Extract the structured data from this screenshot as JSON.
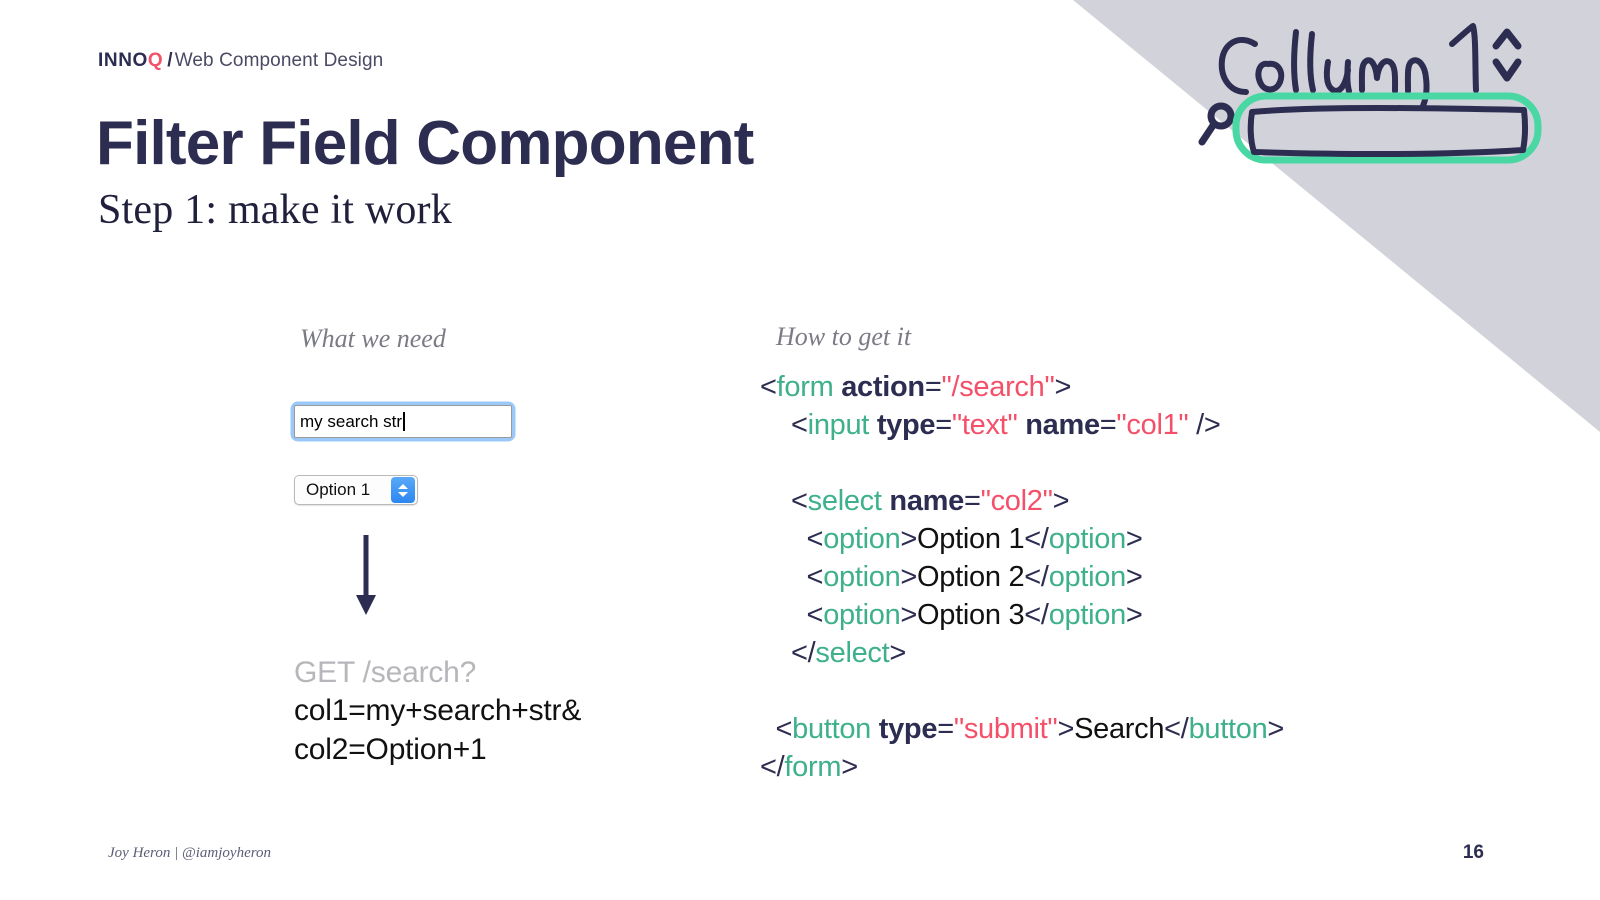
{
  "brand": {
    "name_dark": "INNO",
    "name_accent": "Q",
    "separator": "/",
    "deck_title": "Web Component Design"
  },
  "slide": {
    "title": "Filter Field Component",
    "subtitle": "Step 1: make it work",
    "page_number": "16",
    "credit": "Joy Heron | @iamjoyheron"
  },
  "columns": {
    "left_caption": "What we need",
    "right_caption": "How to get it"
  },
  "demo": {
    "search_input_value": "my search str",
    "search_input_placeholder": "",
    "select_value": "Option 1",
    "select_options": [
      "Option 1",
      "Option 2",
      "Option 3"
    ],
    "arrow_icon": "arrow-down-icon",
    "request_method_path": "GET /search?",
    "request_param_1": "col1=my+search+str&",
    "request_param_2": "col2=Option+1"
  },
  "code": {
    "lines": [
      [
        {
          "t": "<",
          "c": "punc"
        },
        {
          "t": "form",
          "c": "tag"
        },
        {
          "t": " ",
          "c": "punc"
        },
        {
          "t": "action",
          "c": "attr"
        },
        {
          "t": "=",
          "c": "punc"
        },
        {
          "t": "\"/search\"",
          "c": "val"
        },
        {
          "t": ">",
          "c": "punc"
        }
      ],
      [
        {
          "t": "    <",
          "c": "punc"
        },
        {
          "t": "input",
          "c": "tag"
        },
        {
          "t": " ",
          "c": "punc"
        },
        {
          "t": "type",
          "c": "attr"
        },
        {
          "t": "=",
          "c": "punc"
        },
        {
          "t": "\"text\"",
          "c": "val"
        },
        {
          "t": " ",
          "c": "punc"
        },
        {
          "t": "name",
          "c": "attr"
        },
        {
          "t": "=",
          "c": "punc"
        },
        {
          "t": "\"col1\"",
          "c": "val"
        },
        {
          "t": " />",
          "c": "punc"
        }
      ],
      [],
      [
        {
          "t": "    <",
          "c": "punc"
        },
        {
          "t": "select",
          "c": "tag"
        },
        {
          "t": " ",
          "c": "punc"
        },
        {
          "t": "name",
          "c": "attr"
        },
        {
          "t": "=",
          "c": "punc"
        },
        {
          "t": "\"col2\"",
          "c": "val"
        },
        {
          "t": ">",
          "c": "punc"
        }
      ],
      [
        {
          "t": "      <",
          "c": "punc"
        },
        {
          "t": "option",
          "c": "tag"
        },
        {
          "t": ">",
          "c": "punc"
        },
        {
          "t": "Option 1",
          "c": "text"
        },
        {
          "t": "</",
          "c": "punc"
        },
        {
          "t": "option",
          "c": "tag"
        },
        {
          "t": ">",
          "c": "punc"
        }
      ],
      [
        {
          "t": "      <",
          "c": "punc"
        },
        {
          "t": "option",
          "c": "tag"
        },
        {
          "t": ">",
          "c": "punc"
        },
        {
          "t": "Option 2",
          "c": "text"
        },
        {
          "t": "</",
          "c": "punc"
        },
        {
          "t": "option",
          "c": "tag"
        },
        {
          "t": ">",
          "c": "punc"
        }
      ],
      [
        {
          "t": "      <",
          "c": "punc"
        },
        {
          "t": "option",
          "c": "tag"
        },
        {
          "t": ">",
          "c": "punc"
        },
        {
          "t": "Option 3",
          "c": "text"
        },
        {
          "t": "</",
          "c": "punc"
        },
        {
          "t": "option",
          "c": "tag"
        },
        {
          "t": ">",
          "c": "punc"
        }
      ],
      [
        {
          "t": "    </",
          "c": "punc"
        },
        {
          "t": "select",
          "c": "tag"
        },
        {
          "t": ">",
          "c": "punc"
        }
      ],
      [],
      [
        {
          "t": "  <",
          "c": "punc"
        },
        {
          "t": "button",
          "c": "tag"
        },
        {
          "t": " ",
          "c": "punc"
        },
        {
          "t": "type",
          "c": "attr"
        },
        {
          "t": "=",
          "c": "punc"
        },
        {
          "t": "\"submit\"",
          "c": "val"
        },
        {
          "t": ">",
          "c": "punc"
        },
        {
          "t": "Search",
          "c": "text"
        },
        {
          "t": "</",
          "c": "punc"
        },
        {
          "t": "button",
          "c": "tag"
        },
        {
          "t": ">",
          "c": "punc"
        }
      ],
      [
        {
          "t": "</",
          "c": "punc"
        },
        {
          "t": "form",
          "c": "tag"
        },
        {
          "t": ">",
          "c": "punc"
        }
      ]
    ]
  },
  "sketch": {
    "label": "Column 1",
    "sort_icon": "sort-updown-icon",
    "search_icon": "magnifier-icon",
    "field_icon": "sketched-input-box",
    "highlight_color": "#49d7a4",
    "ink_color": "#2d2d52"
  },
  "colors": {
    "ink_navy": "#2d2d52",
    "accent_red": "#f4506a",
    "accent_teal": "#3fb08c",
    "corner_gray": "#d2d2da",
    "muted_gray": "#b6b6bb"
  }
}
